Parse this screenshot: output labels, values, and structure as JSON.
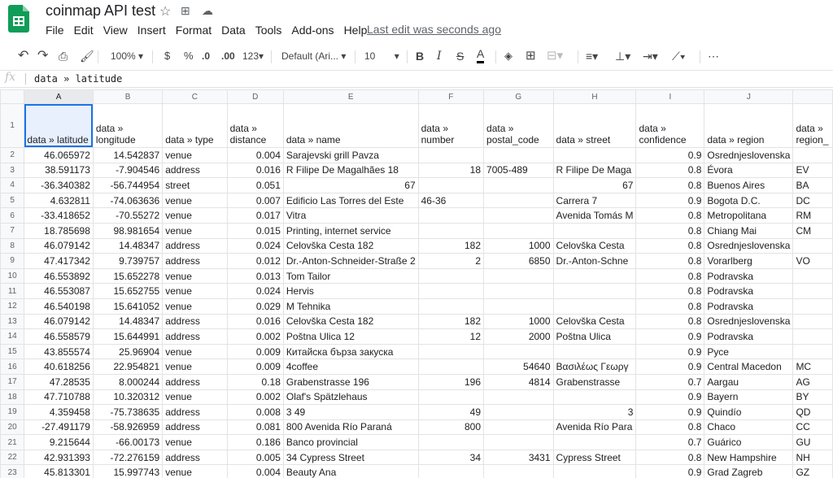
{
  "app": {
    "doc_title": "coinmap API test",
    "menu": [
      "File",
      "Edit",
      "View",
      "Insert",
      "Format",
      "Data",
      "Tools",
      "Add-ons",
      "Help"
    ],
    "last_edit": "Last edit was seconds ago"
  },
  "toolbar": {
    "zoom": "100%",
    "currency": "$",
    "percent": "%",
    "decrease_decimals": ".0",
    "increase_decimals": ".00",
    "more_formats": "123",
    "font": "Default (Ari...",
    "font_size": "10"
  },
  "formula_bar": {
    "fx": "fx",
    "content": "data » latitude"
  },
  "grid": {
    "columns": [
      "A",
      "B",
      "C",
      "D",
      "E",
      "F",
      "G",
      "H",
      "I",
      "J",
      ""
    ],
    "header_row": [
      "data » latitude",
      "data » longitude",
      "data » type",
      "data » distance",
      "data » name",
      "data » number",
      "data » postal_code",
      "data » street",
      "data » confidence",
      "data » region",
      "data » region_"
    ],
    "rows": [
      [
        "46.065972",
        "14.542837",
        "venue",
        "0.004",
        "Sarajevski grill Pavza",
        "",
        "",
        "",
        "0.9",
        "Osrednjeslovenska",
        ""
      ],
      [
        "38.591173",
        "-7.904546",
        "address",
        "0.016",
        "R Filipe De Magalhães 18",
        "18",
        "7005-489",
        "R Filipe De Maga",
        "0.8",
        "Évora",
        "EV"
      ],
      [
        "-36.340382",
        "-56.744954",
        "street",
        "0.051",
        "67",
        "",
        "",
        "67",
        "0.8",
        "Buenos Aires",
        "BA"
      ],
      [
        "4.632811",
        "-74.063636",
        "venue",
        "0.007",
        "Edificio Las Torres del Este",
        "46-36",
        "",
        "Carrera 7",
        "0.9",
        "Bogota D.C.",
        "DC"
      ],
      [
        "-33.418652",
        "-70.55272",
        "venue",
        "0.017",
        "Vitra",
        "",
        "",
        "Avenida Tomás M",
        "0.8",
        "Metropolitana",
        "RM"
      ],
      [
        "18.785698",
        "98.981654",
        "venue",
        "0.015",
        "Printing, internet service",
        "",
        "",
        "",
        "0.8",
        "Chiang Mai",
        "CM"
      ],
      [
        "46.079142",
        "14.48347",
        "address",
        "0.024",
        "Celovška Cesta 182",
        "182",
        "1000",
        "Celovška Cesta",
        "0.8",
        "Osrednjeslovenska",
        ""
      ],
      [
        "47.417342",
        "9.739757",
        "address",
        "0.012",
        "Dr.-Anton-Schneider-Straße 2",
        "2",
        "6850",
        "Dr.-Anton-Schne",
        "0.8",
        "Vorarlberg",
        "VO"
      ],
      [
        "46.553892",
        "15.652278",
        "venue",
        "0.013",
        "Tom Tailor",
        "",
        "",
        "",
        "0.8",
        "Podravska",
        ""
      ],
      [
        "46.553087",
        "15.652755",
        "venue",
        "0.024",
        "Hervis",
        "",
        "",
        "",
        "0.8",
        "Podravska",
        ""
      ],
      [
        "46.540198",
        "15.641052",
        "venue",
        "0.029",
        "M Tehnika",
        "",
        "",
        "",
        "0.8",
        "Podravska",
        ""
      ],
      [
        "46.079142",
        "14.48347",
        "address",
        "0.016",
        "Celovška Cesta 182",
        "182",
        "1000",
        "Celovška Cesta",
        "0.8",
        "Osrednjeslovenska",
        ""
      ],
      [
        "46.558579",
        "15.644991",
        "address",
        "0.002",
        "Poštna Ulica 12",
        "12",
        "2000",
        "Poštna Ulica",
        "0.9",
        "Podravska",
        ""
      ],
      [
        "43.855574",
        "25.96904",
        "venue",
        "0.009",
        "Китайска бърза закуска",
        "",
        "",
        "",
        "0.9",
        "Русе",
        ""
      ],
      [
        "40.618256",
        "22.954821",
        "venue",
        "0.009",
        "4coffee",
        "",
        "54640",
        "Βασιλέως Γεωργ",
        "0.9",
        "Central Macedon",
        "MC"
      ],
      [
        "47.28535",
        "8.000244",
        "address",
        "0.18",
        "Grabenstrasse 196",
        "196",
        "4814",
        "Grabenstrasse",
        "0.7",
        "Aargau",
        "AG"
      ],
      [
        "47.710788",
        "10.320312",
        "venue",
        "0.002",
        "Olaf's Spätzlehaus",
        "",
        "",
        "",
        "0.9",
        "Bayern",
        "BY"
      ],
      [
        "4.359458",
        "-75.738635",
        "address",
        "0.008",
        "3 49",
        "49",
        "",
        "3",
        "0.9",
        "Quindío",
        "QD"
      ],
      [
        "-27.491179",
        "-58.926959",
        "address",
        "0.081",
        "800 Avenida Río Paraná",
        "800",
        "",
        "Avenida Río Para",
        "0.8",
        "Chaco",
        "CC"
      ],
      [
        "9.215644",
        "-66.00173",
        "venue",
        "0.186",
        "Banco provincial",
        "",
        "",
        "",
        "0.7",
        "Guárico",
        "GU"
      ],
      [
        "42.931393",
        "-72.276159",
        "address",
        "0.005",
        "34 Cypress Street",
        "34",
        "3431",
        "Cypress Street",
        "0.8",
        "New Hampshire",
        "NH"
      ],
      [
        "45.813301",
        "15.997743",
        "venue",
        "0.004",
        "Beauty Ana",
        "",
        "",
        "",
        "0.9",
        "Grad Zagreb",
        "GZ"
      ]
    ]
  }
}
